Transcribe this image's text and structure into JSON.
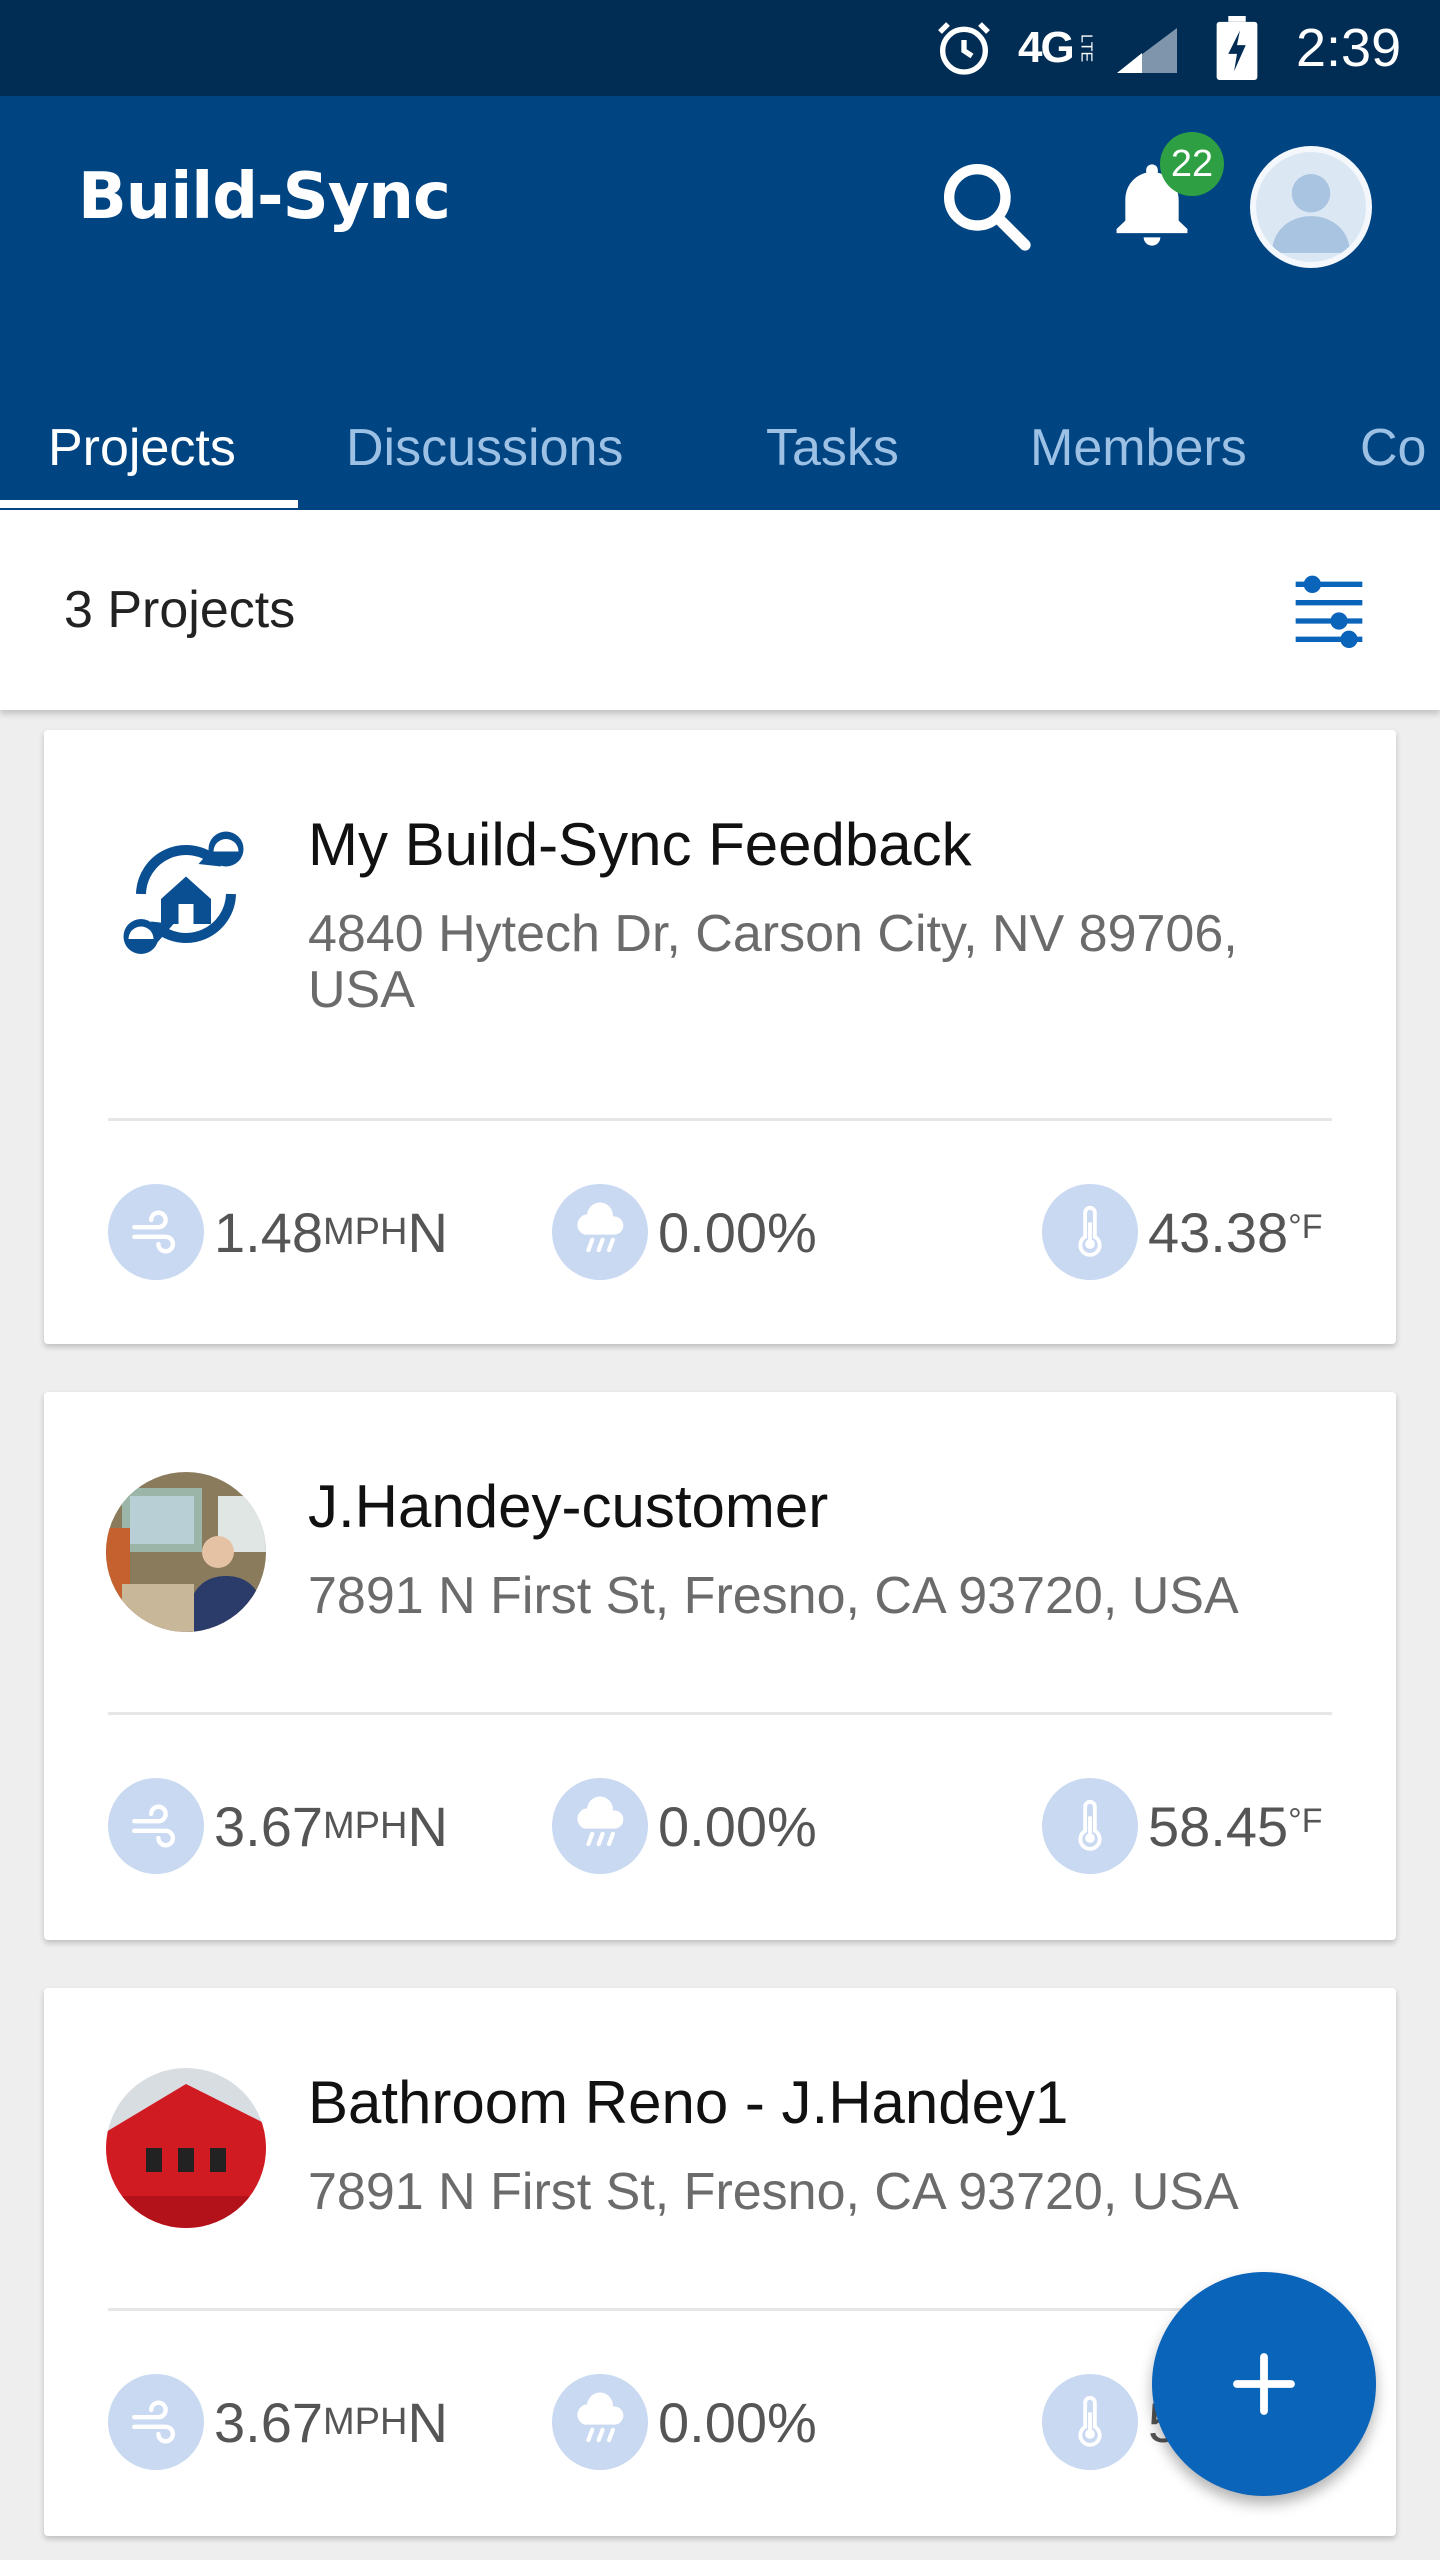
{
  "status_bar": {
    "network": "4G",
    "network_sub": "LTE",
    "time": "2:39"
  },
  "app": {
    "title": "Build-Sync",
    "notification_count": "22"
  },
  "tabs": [
    {
      "label": "Projects",
      "active": true
    },
    {
      "label": "Discussions",
      "active": false
    },
    {
      "label": "Tasks",
      "active": false
    },
    {
      "label": "Members",
      "active": false
    },
    {
      "label": "Co",
      "active": false
    }
  ],
  "list": {
    "count_label": "3 Projects"
  },
  "projects": [
    {
      "name": "My Build-Sync Feedback",
      "address": "4840 Hytech Dr, Carson City, NV 89706, USA",
      "wind": "1.48",
      "wind_unit": "MPH",
      "wind_dir": "N",
      "precip": "0.00%",
      "temp": "43.38",
      "temp_unit": "°F"
    },
    {
      "name": "J.Handey-customer",
      "address": "7891 N First St, Fresno, CA 93720, USA",
      "wind": "3.67",
      "wind_unit": "MPH",
      "wind_dir": "N",
      "precip": "0.00%",
      "temp": "58.45",
      "temp_unit": "°F"
    },
    {
      "name": "Bathroom Reno - J.Handey1",
      "address": "7891 N First St, Fresno, CA 93720, USA",
      "wind": "3.67",
      "wind_unit": "MPH",
      "wind_dir": "N",
      "precip": "0.00%",
      "temp": "5"
    }
  ],
  "colors": {
    "status_bar": "#012d55",
    "app_bar": "#004482",
    "tab_inactive": "#9cc1e4",
    "badge": "#2ea043",
    "fab": "#0a64ba",
    "metric_icon_bg": "#c9d9f2"
  },
  "icons": {
    "search": "search-icon",
    "bell": "bell-icon",
    "filter": "filter-sliders-icon",
    "wind": "wind-icon",
    "rain": "rain-cloud-icon",
    "temperature": "thermometer-icon",
    "add": "plus-icon"
  }
}
